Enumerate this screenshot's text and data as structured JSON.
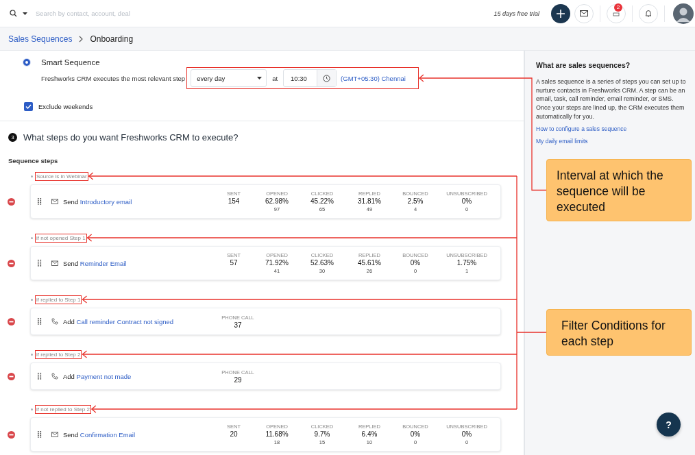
{
  "topbar": {
    "search_placeholder": "Search by contact, account, deal",
    "trial": "15 days free trial",
    "notification_count": "2"
  },
  "breadcrumb": [
    "Sales Sequences",
    "Onboarding"
  ],
  "schedule": {
    "title": "Smart Sequence",
    "selected": true,
    "description": "Freshworks CRM executes the most relevant step",
    "frequency": "every day",
    "at": "at",
    "time": "10:30",
    "timezone": "(GMT+05:30) Chennai"
  },
  "exclude_weekends": {
    "label": "Exclude weekends",
    "checked": true
  },
  "section": {
    "number": "3",
    "title": "What steps do you want Freshworks CRM to execute?"
  },
  "steps_label": "Sequence steps",
  "steps": [
    {
      "condition": "Source is in Webinar",
      "kind": "email",
      "verb": "Send",
      "name": "Introductory email",
      "stats": [
        {
          "label": "SENT",
          "value": "154"
        },
        {
          "label": "OPENED",
          "value": "62.98%",
          "count": "97"
        },
        {
          "label": "CLICKED",
          "value": "45.22%",
          "count": "65"
        },
        {
          "label": "REPLIED",
          "value": "31.81%",
          "count": "49"
        },
        {
          "label": "BOUNCED",
          "value": "2.5%",
          "count": "4"
        },
        {
          "label": "UNSUBSCRIBED",
          "value": "0%",
          "count": "0"
        }
      ]
    },
    {
      "condition": "if not opened Step 1",
      "kind": "email",
      "verb": "Send",
      "name": "Reminder Email",
      "stats": [
        {
          "label": "SENT",
          "value": "57"
        },
        {
          "label": "OPENED",
          "value": "71.92%",
          "count": "41"
        },
        {
          "label": "CLICKED",
          "value": "52.63%",
          "count": "30"
        },
        {
          "label": "REPLIED",
          "value": "45.61%",
          "count": "26"
        },
        {
          "label": "BOUNCED",
          "value": "0%",
          "count": "0"
        },
        {
          "label": "UNSUBSCRIBED",
          "value": "1.75%",
          "count": "1"
        }
      ]
    },
    {
      "condition": "if replied to Step 1",
      "kind": "call",
      "verb": "Add",
      "name": "Call reminder Contract not signed",
      "stats": [
        {
          "label": "PHONE CALL",
          "value": "37"
        }
      ]
    },
    {
      "condition": "if replied to Step 2",
      "kind": "call",
      "verb": "Add",
      "name": "Payment not made",
      "stats": [
        {
          "label": "PHONE CALL",
          "value": "29"
        }
      ]
    },
    {
      "condition": "if not replied to Step 2",
      "kind": "email",
      "verb": "Send",
      "name": "Confirmation Email",
      "stats": [
        {
          "label": "SENT",
          "value": "20"
        },
        {
          "label": "OPENED",
          "value": "11.68%",
          "count": "18"
        },
        {
          "label": "CLICKED",
          "value": "9.7%",
          "count": "15"
        },
        {
          "label": "REPLIED",
          "value": "6.4%",
          "count": "10"
        },
        {
          "label": "BOUNCED",
          "value": "0%",
          "count": "0"
        },
        {
          "label": "UNSUBSCRIBED",
          "value": "0%",
          "count": "0"
        }
      ]
    }
  ],
  "help": {
    "title": "What are sales sequences?",
    "body": "A sales sequence is a series of steps you can set up to nurture contacts in Freshworks CRM. A step can be an email, task, call reminder, email reminder, or SMS. Once your steps are lined up, the CRM executes them automatically for you.",
    "links": [
      "How to configure a sales sequence",
      "My daily email limits"
    ]
  },
  "annotations": [
    {
      "text": "Interval at which the sequence will be executed"
    },
    {
      "text": "Filter Conditions for each step"
    }
  ],
  "help_button": "?"
}
